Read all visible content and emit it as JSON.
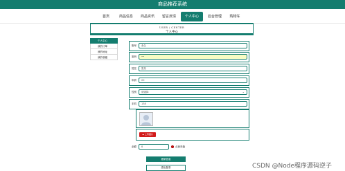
{
  "app_title": "商品推荐系统",
  "nav": {
    "items": [
      {
        "label": "首页",
        "active": false
      },
      {
        "label": "商品信息",
        "active": false
      },
      {
        "label": "商品资讯",
        "active": false
      },
      {
        "label": "留言反馈",
        "active": false
      },
      {
        "label": "个人中心",
        "active": true
      },
      {
        "label": "后台管理",
        "active": false
      },
      {
        "label": "购物车",
        "active": false
      }
    ]
  },
  "banner": {
    "en": "USER / CENTER",
    "cn": "个人中心"
  },
  "sidebar": {
    "items": [
      {
        "label": "个人中心",
        "active": true
      },
      {
        "label": "我的订单",
        "active": false
      },
      {
        "label": "我的地址",
        "active": false
      },
      {
        "label": "我的收藏",
        "active": false
      }
    ]
  },
  "form": {
    "account": {
      "label": "账号",
      "value": "永久"
    },
    "password": {
      "label": "密码",
      "value": "••"
    },
    "name": {
      "label": "姓名",
      "value": "张东"
    },
    "age": {
      "label": "年龄",
      "value": "20"
    },
    "gender": {
      "label": "性别",
      "value": "请选择"
    },
    "phone": {
      "label": "手机",
      "value": "138"
    },
    "upload_label": "上传图片",
    "balance": {
      "label": "余额",
      "value": "0"
    },
    "recharge_label": "点我充值",
    "update_button": "更新信息",
    "logout_button": "退出登录"
  },
  "watermark": "CSDN @Node程序源码逆子",
  "colors": {
    "accent": "#147d6f",
    "highlight": "#f7fcc4",
    "danger": "#d21b1b"
  }
}
